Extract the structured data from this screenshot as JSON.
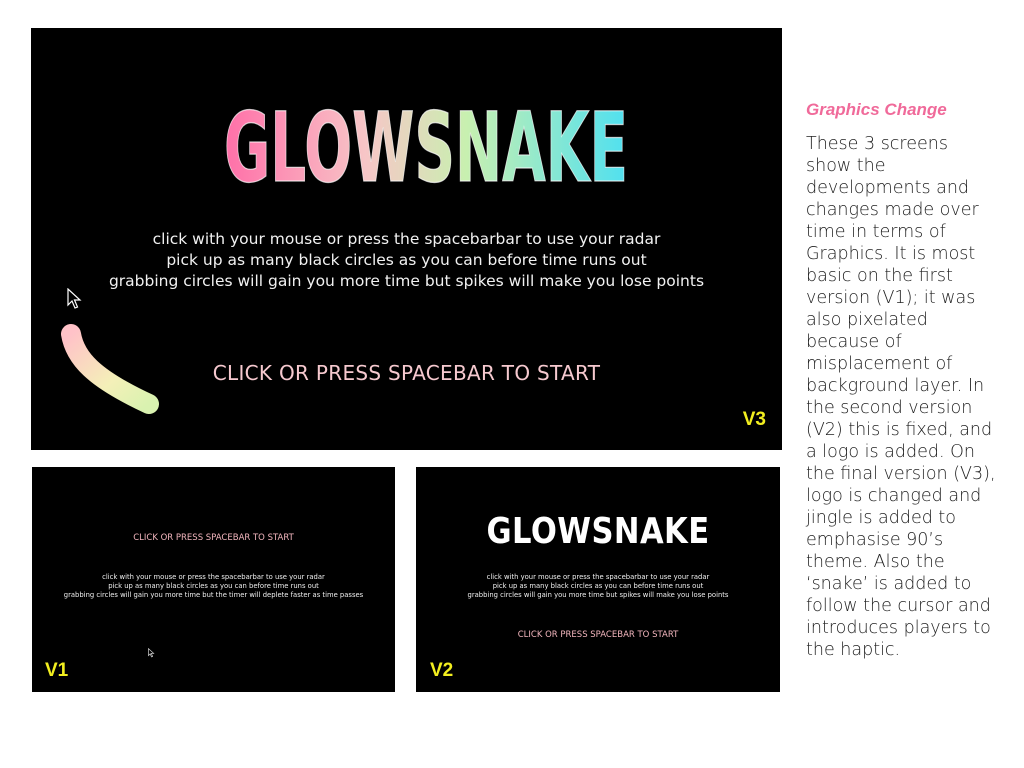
{
  "v3": {
    "logo_text": "GLOWSNAKE",
    "instructions": [
      "click with your mouse or press the spacebarbar to use your radar",
      "pick up as many black circles as you can before time runs out",
      "grabbing circles will gain you more time but spikes will make you lose points"
    ],
    "start_text": "CLICK OR PRESS SPACEBAR TO START",
    "label": "V3"
  },
  "v1": {
    "start_text": "CLICK OR PRESS SPACEBAR TO START",
    "instructions": [
      "click with your mouse or press the spacebarbar to use your radar",
      "pick up as many black circles as you can before time runs out",
      "grabbing circles will gain you more time but the timer will deplete faster as time passes"
    ],
    "label": "V1"
  },
  "v2": {
    "logo_text": "GLOWSNAKE",
    "instructions": [
      "click with your mouse or press the spacebarbar to use your radar",
      "pick up as many black circles as you can before time runs out",
      "grabbing circles will gain you more time but spikes will make you lose points"
    ],
    "start_text": "CLICK OR PRESS SPACEBAR TO START",
    "label": "V2"
  },
  "side": {
    "title": "Graphics Change",
    "lines": [
      "These 3 screens",
      "show the",
      "developments and",
      "changes made over",
      "time in terms of",
      "Graphics. It is most",
      "basic on the first",
      "version (V1); it was",
      "also pixelated",
      "because of",
      "misplacement of",
      "background layer. In",
      "the second version",
      "(V2) this is fixed, and",
      "a logo is added. On",
      "the final version (V3),",
      "logo is changed and",
      "jingle is added to",
      "emphasise 90’s",
      "theme. Also the",
      "‘snake’ is added to",
      "follow the cursor and",
      "introduces players to",
      "the haptic."
    ]
  },
  "colors": {
    "screen_bg": "#000000",
    "version_label": "#f2ee1f",
    "start_text": "#f6c9cf",
    "title_pink": "#f06a9a",
    "logo_gradient": [
      "#ff6fa8",
      "#f7c6c7",
      "#c8f0b0",
      "#5ee0ee"
    ]
  }
}
